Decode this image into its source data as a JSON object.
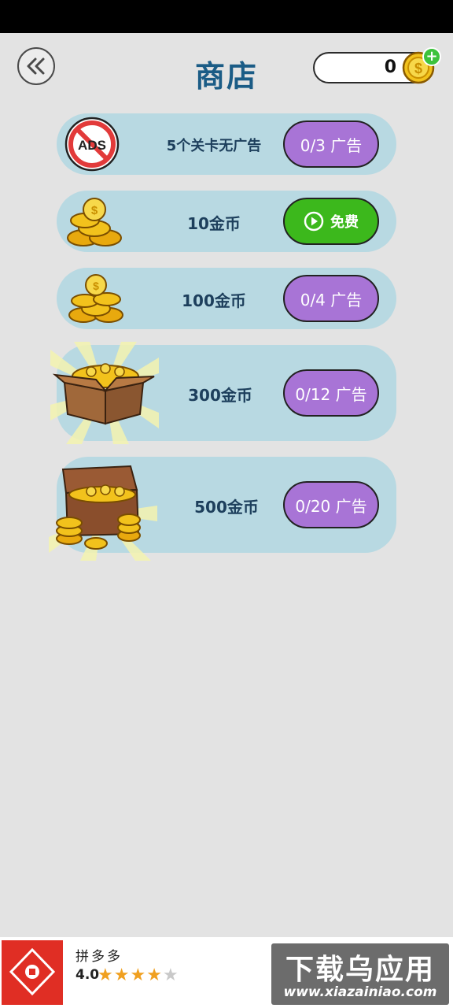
{
  "header": {
    "title": "商店",
    "coin_count": "0"
  },
  "shop": {
    "items": [
      {
        "label": "5个关卡无广告",
        "button": "0/3 广告",
        "icon": "no-ads-icon"
      },
      {
        "label": "10金币",
        "button": "免费",
        "icon": "coin-stack-small-icon"
      },
      {
        "label": "100金币",
        "button": "0/4 广告",
        "icon": "coin-stack-medium-icon"
      },
      {
        "label": "300金币",
        "button": "0/12 广告",
        "icon": "coin-box-icon"
      },
      {
        "label": "500金币",
        "button": "0/20 广告",
        "icon": "treasure-chest-icon"
      }
    ]
  },
  "ad": {
    "app_name": "拼多多",
    "rating": "4.0",
    "stars_filled": 4,
    "stars_total": 5,
    "watermark_text": "下载乌应用",
    "watermark_url": "www.xiazainiao.com"
  },
  "colors": {
    "title": "#1b5c86",
    "row_background": "#b8d9e2",
    "button_purple": "#a874d6",
    "button_green": "#3cb81c",
    "coin_gold": "#f2c21c"
  }
}
